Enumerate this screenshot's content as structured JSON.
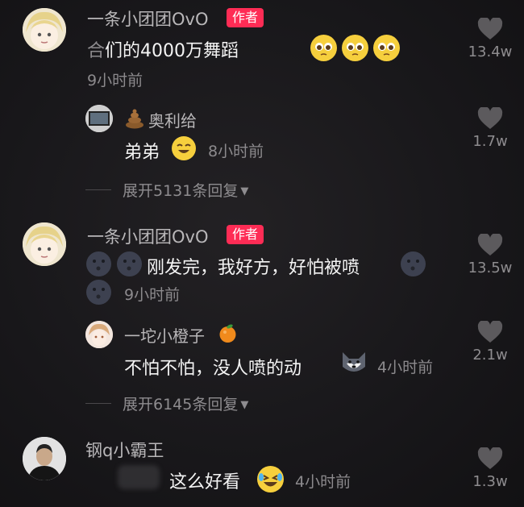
{
  "comments": [
    {
      "username": "一条小团团OvO",
      "badge": "作者",
      "text": "们的4000万舞蹈",
      "text_prefix_obscured": "合",
      "time": "9小时前",
      "likes": "13.4w",
      "replies": [
        {
          "username": "奥利给",
          "name_emoji": "poop-emoji",
          "text": "弟弟",
          "time": "8小时前",
          "likes": "1.7w"
        }
      ],
      "expand": "展开5131条回复"
    },
    {
      "username": "一条小团团OvO",
      "badge": "作者",
      "text": "刚发完，我好方，好怕被喷",
      "time": "9小时前",
      "likes": "13.5w",
      "replies": [
        {
          "username": "一坨小橙子",
          "name_emoji": "orange-emoji",
          "text": "不怕不怕，没人喷的动",
          "time": "4小时前",
          "likes": "2.1w"
        }
      ],
      "expand": "展开6145条回复"
    },
    {
      "username": "钢q小霸王",
      "text": "这么好看",
      "time": "4小时前",
      "likes": "1.3w"
    }
  ],
  "colors": {
    "badge": "#fe2c55",
    "name": "#b9b7b9",
    "muted": "#8c8a8d",
    "text": "#f4f4f4"
  }
}
